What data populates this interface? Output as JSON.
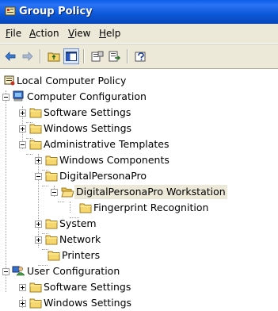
{
  "window": {
    "title": "Group Policy"
  },
  "menu": [
    {
      "label": "File",
      "accel": "F",
      "rest": "ile"
    },
    {
      "label": "Action",
      "accel": "A",
      "rest": "ction"
    },
    {
      "label": "View",
      "accel": "V",
      "rest": "iew"
    },
    {
      "label": "Help",
      "accel": "H",
      "rest": "elp"
    }
  ],
  "toolbar": {
    "buttons": [
      "back-arrow-icon",
      "forward-arrow-icon",
      "up-folder-icon",
      "show-hide-tree-icon",
      "properties-icon",
      "export-list-icon",
      "help-icon"
    ],
    "active_button": "show-hide-tree-icon"
  },
  "tree": {
    "root": "Local Computer Policy",
    "computer_config": "Computer Configuration",
    "cc_software": "Software Settings",
    "cc_windows": "Windows Settings",
    "cc_admin": "Administrative Templates",
    "windows_components": "Windows Components",
    "digitalpersonapro": "DigitalPersonaPro",
    "dpp_workstation": "DigitalPersonaPro Workstation",
    "fingerprint": "Fingerprint Recognition",
    "system": "System",
    "network": "Network",
    "printers": "Printers",
    "user_config": "User Configuration",
    "uc_software": "Software Settings",
    "uc_windows": "Windows Settings"
  },
  "colors": {
    "titlebar": "#0b58d8",
    "chrome": "#ece9d8",
    "folder": "#f5d76e"
  }
}
